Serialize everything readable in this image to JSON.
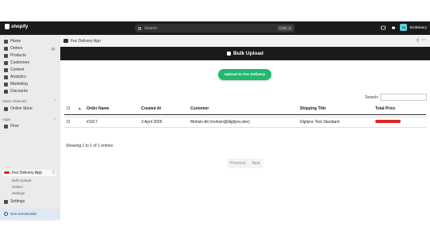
{
  "topbar": {
    "brand": "shopify",
    "search_placeholder": "Search",
    "kbd_ctrl": "CTRL",
    "kbd_k": "K",
    "store_initials": "fd",
    "store_name": "fezdelivery"
  },
  "sidebar": {
    "items": [
      {
        "label": "Home"
      },
      {
        "label": "Orders",
        "badge": "4"
      },
      {
        "label": "Products"
      },
      {
        "label": "Customers"
      },
      {
        "label": "Content"
      },
      {
        "label": "Analytics"
      },
      {
        "label": "Marketing"
      },
      {
        "label": "Discounts"
      }
    ],
    "sales_channels_heading": "Sales channels",
    "online_store": "Online Store",
    "apps_heading": "Apps",
    "flow": "Flow",
    "active_app": "Fez Delivery App",
    "app_subitems": [
      "Bulk Upload",
      "Orders",
      "Settings"
    ],
    "settings": "Settings",
    "non_transferable": "Non-transferable"
  },
  "app_bar": {
    "title": "Fez Delivery App"
  },
  "page": {
    "title": "Bulk Upload",
    "upload_button": "Upload to Fez Delivery",
    "search_label": "Search:"
  },
  "table": {
    "columns": [
      "Order Name",
      "Created At",
      "Customer",
      "Shipping Title",
      "Total Price"
    ],
    "rows": [
      {
        "order_name": "#1017",
        "created_at": "3 April 2025",
        "customer": "Mohsin Ali (mohsin@digilynx.dev)",
        "shipping_title": "Digilynx Test Standard"
      }
    ],
    "summary": "Showing 1 to 1 of 1 entries",
    "pager_prev": "Previous",
    "pager_next": "Next"
  },
  "colors": {
    "topbar": "#1a1a1a",
    "accent_green": "#21b86f",
    "redaction": "#e02020"
  }
}
